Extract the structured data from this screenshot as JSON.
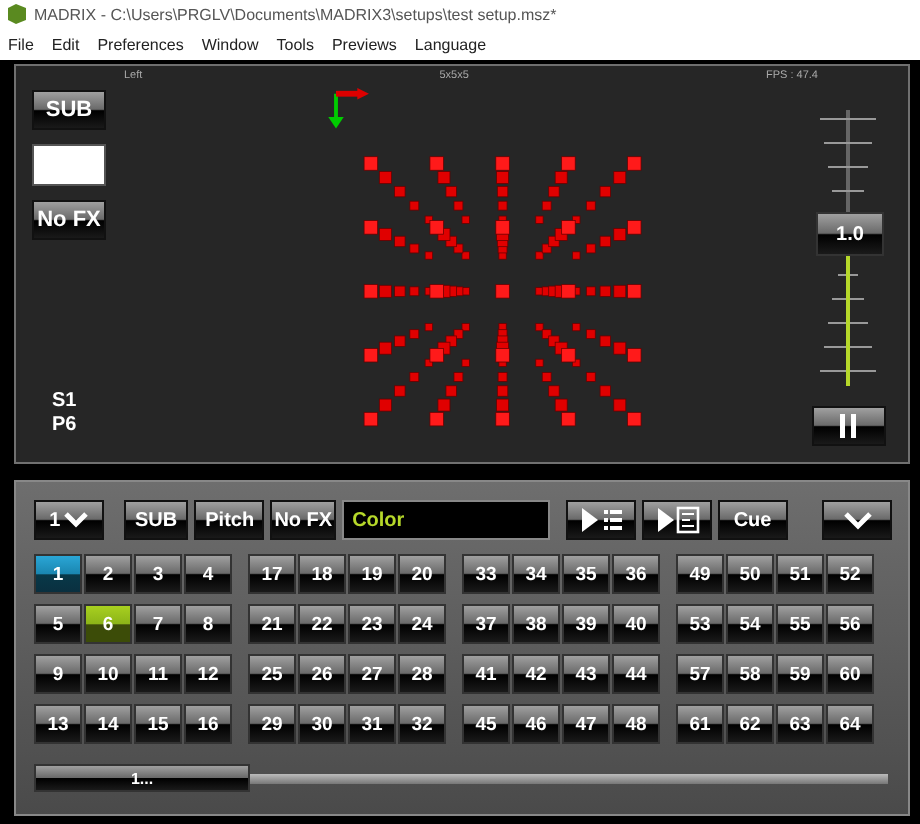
{
  "window": {
    "title": "MADRIX - C:\\Users\\PRGLV\\Documents\\MADRIX3\\setups\\test setup.msz*"
  },
  "menu": [
    "File",
    "Edit",
    "Preferences",
    "Window",
    "Tools",
    "Previews",
    "Language"
  ],
  "preview": {
    "view": "Left",
    "size": "5x5x5",
    "fps": "FPS : 47.4",
    "sub": "SUB",
    "nofx": "No FX",
    "storage": "S1",
    "place": "P6",
    "speed": {
      "reading": "1.0",
      "level": 0.55
    }
  },
  "cues": {
    "storage": "1",
    "buttons": [
      "SUB",
      "Pitch",
      "No FX"
    ],
    "effect": "Color",
    "cue": "Cue",
    "places": [
      [
        {
          "label": "1",
          "active": true,
          "selected": false
        },
        {
          "label": "2",
          "active": false,
          "selected": false
        },
        {
          "label": "3",
          "active": false,
          "selected": false
        },
        {
          "label": "4",
          "active": false,
          "selected": false
        },
        {
          "label": "5",
          "active": false,
          "selected": false
        },
        {
          "label": "6",
          "active": false,
          "selected": true
        },
        {
          "label": "7",
          "active": false,
          "selected": false
        },
        {
          "label": "8",
          "active": false,
          "selected": false
        },
        {
          "label": "9",
          "active": false,
          "selected": false
        },
        {
          "label": "10",
          "active": false,
          "selected": false
        },
        {
          "label": "11",
          "active": false,
          "selected": false
        },
        {
          "label": "12",
          "active": false,
          "selected": false
        },
        {
          "label": "13",
          "active": false,
          "selected": false
        },
        {
          "label": "14",
          "active": false,
          "selected": false
        },
        {
          "label": "15",
          "active": false,
          "selected": false
        },
        {
          "label": "16",
          "active": false,
          "selected": false
        }
      ],
      [
        {
          "label": "17",
          "active": false,
          "selected": false
        },
        {
          "label": "18",
          "active": false,
          "selected": false
        },
        {
          "label": "19",
          "active": false,
          "selected": false
        },
        {
          "label": "20",
          "active": false,
          "selected": false
        },
        {
          "label": "21",
          "active": false,
          "selected": false
        },
        {
          "label": "22",
          "active": false,
          "selected": false
        },
        {
          "label": "23",
          "active": false,
          "selected": false
        },
        {
          "label": "24",
          "active": false,
          "selected": false
        },
        {
          "label": "25",
          "active": false,
          "selected": false
        },
        {
          "label": "26",
          "active": false,
          "selected": false
        },
        {
          "label": "27",
          "active": false,
          "selected": false
        },
        {
          "label": "28",
          "active": false,
          "selected": false
        },
        {
          "label": "29",
          "active": false,
          "selected": false
        },
        {
          "label": "30",
          "active": false,
          "selected": false
        },
        {
          "label": "31",
          "active": false,
          "selected": false
        },
        {
          "label": "32",
          "active": false,
          "selected": false
        }
      ],
      [
        {
          "label": "33",
          "active": false,
          "selected": false
        },
        {
          "label": "34",
          "active": false,
          "selected": false
        },
        {
          "label": "35",
          "active": false,
          "selected": false
        },
        {
          "label": "36",
          "active": false,
          "selected": false
        },
        {
          "label": "37",
          "active": false,
          "selected": false
        },
        {
          "label": "38",
          "active": false,
          "selected": false
        },
        {
          "label": "39",
          "active": false,
          "selected": false
        },
        {
          "label": "40",
          "active": false,
          "selected": false
        },
        {
          "label": "41",
          "active": false,
          "selected": false
        },
        {
          "label": "42",
          "active": false,
          "selected": false
        },
        {
          "label": "43",
          "active": false,
          "selected": false
        },
        {
          "label": "44",
          "active": false,
          "selected": false
        },
        {
          "label": "45",
          "active": false,
          "selected": false
        },
        {
          "label": "46",
          "active": false,
          "selected": false
        },
        {
          "label": "47",
          "active": false,
          "selected": false
        },
        {
          "label": "48",
          "active": false,
          "selected": false
        }
      ],
      [
        {
          "label": "49",
          "active": false,
          "selected": false
        },
        {
          "label": "50",
          "active": false,
          "selected": false
        },
        {
          "label": "51",
          "active": false,
          "selected": false
        },
        {
          "label": "52",
          "active": false,
          "selected": false
        },
        {
          "label": "53",
          "active": false,
          "selected": false
        },
        {
          "label": "54",
          "active": false,
          "selected": false
        },
        {
          "label": "55",
          "active": false,
          "selected": false
        },
        {
          "label": "56",
          "active": false,
          "selected": false
        },
        {
          "label": "57",
          "active": false,
          "selected": false
        },
        {
          "label": "58",
          "active": false,
          "selected": false
        },
        {
          "label": "59",
          "active": false,
          "selected": false
        },
        {
          "label": "60",
          "active": false,
          "selected": false
        },
        {
          "label": "61",
          "active": false,
          "selected": false
        },
        {
          "label": "62",
          "active": false,
          "selected": false
        },
        {
          "label": "63",
          "active": false,
          "selected": false
        },
        {
          "label": "64",
          "active": false,
          "selected": false
        }
      ]
    ]
  },
  "scroll": {
    "label": "1..."
  }
}
